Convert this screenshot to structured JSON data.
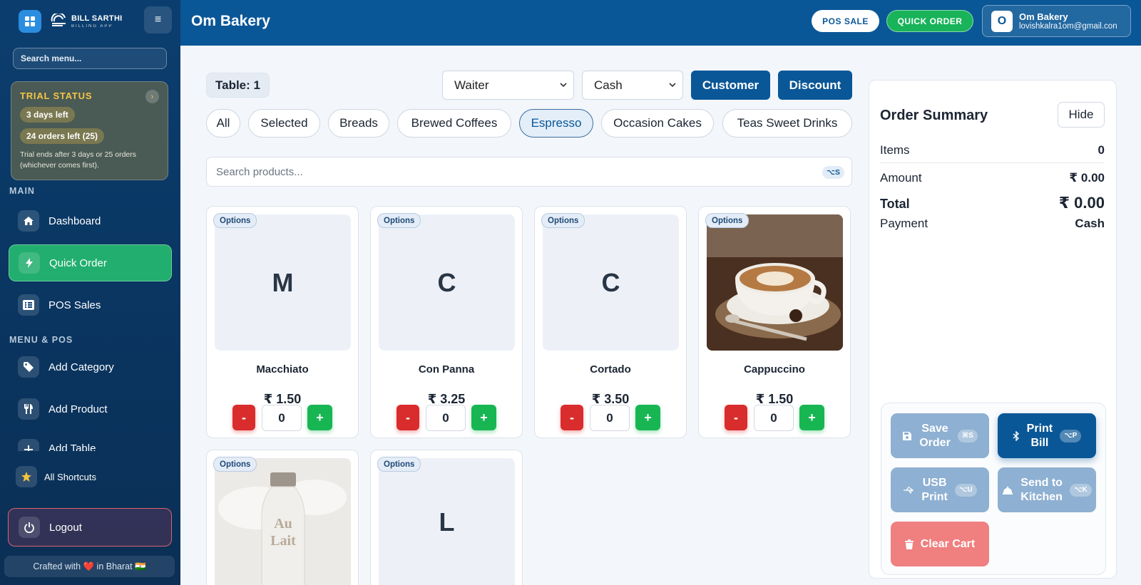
{
  "brand": {
    "name": "BILL SARTHI",
    "tagline": "BILLING APP"
  },
  "sidebar": {
    "search_placeholder": "Search menu...",
    "trial": {
      "title": "TRIAL STATUS",
      "days_left": "3 days left",
      "orders_left": "24 orders left (25)",
      "note": "Trial ends after 3 days or 25 orders (whichever comes first)."
    },
    "section_main": "MAIN",
    "section_menu": "MENU & POS",
    "items": [
      {
        "label": "Dashboard",
        "icon": "home-icon"
      },
      {
        "label": "Quick Order",
        "icon": "bolt-icon",
        "active": true
      },
      {
        "label": "POS Sales",
        "icon": "list-icon"
      },
      {
        "label": "Add Category",
        "icon": "tag-icon"
      },
      {
        "label": "Add Product",
        "icon": "utensils-icon"
      },
      {
        "label": "Add Table",
        "icon": "plus-icon"
      }
    ],
    "shortcuts_label": "All Shortcuts",
    "logout_label": "Logout",
    "crafted": "Crafted with ❤️ in Bharat 🇮🇳"
  },
  "header": {
    "title": "Om Bakery",
    "pos_sale": "POS SALE",
    "quick_order": "QUICK ORDER",
    "account": {
      "initial": "O",
      "name": "Om Bakery",
      "email": "lovishkalra1om@gmail.con"
    }
  },
  "order_bar": {
    "table": "Table: 1",
    "waiter": "Waiter",
    "payment": "Cash",
    "customer_btn": "Customer",
    "discount_btn": "Discount"
  },
  "categories": [
    {
      "label": "All"
    },
    {
      "label": "Selected"
    },
    {
      "label": "Breads"
    },
    {
      "label": "Brewed Coffees"
    },
    {
      "label": "Espresso",
      "active": true
    },
    {
      "label": "Occasion Cakes"
    },
    {
      "label": "Teas Sweet Drinks"
    }
  ],
  "search": {
    "placeholder": "Search products...",
    "shortcut": "⌥S"
  },
  "products": [
    {
      "badge": "Options",
      "letter": "M",
      "name": "Macchiato",
      "price": "₹ 1.50",
      "qty": "0"
    },
    {
      "badge": "Options",
      "letter": "C",
      "name": "Con Panna",
      "price": "₹ 3.25",
      "qty": "0"
    },
    {
      "badge": "Options",
      "letter": "C",
      "name": "Cortado",
      "price": "₹ 3.50",
      "qty": "0"
    },
    {
      "badge": "Options",
      "letter": "",
      "name": "Cappuccino",
      "price": "₹ 1.50",
      "qty": "0",
      "image": "cappuccino-photo"
    },
    {
      "badge": "Options",
      "letter": "",
      "name": "",
      "price": "",
      "qty": "",
      "image": "au-lait-bottle-photo",
      "image_text": "Au Lait"
    },
    {
      "badge": "Options",
      "letter": "L",
      "name": "",
      "price": "",
      "qty": ""
    }
  ],
  "qty_minus": "-",
  "qty_plus": "+",
  "summary": {
    "title": "Order Summary",
    "hide": "Hide",
    "items_label": "Items",
    "items_value": "0",
    "amount_label": "Amount",
    "amount_value": "₹ 0.00",
    "total_label": "Total",
    "total_value": "₹ 0.00",
    "payment_label": "Payment",
    "payment_value": "Cash"
  },
  "actions": {
    "save": {
      "line1": "Save",
      "line2": "Order",
      "key": "⌘S"
    },
    "print": {
      "line1": "Print",
      "line2": "Bill",
      "key": "⌥P"
    },
    "usb": {
      "line1": "USB",
      "line2": "Print",
      "key": "⌥U"
    },
    "kitchen": {
      "line1": "Send to",
      "line2": "Kitchen",
      "key": "⌥K"
    },
    "clear": "Clear Cart"
  },
  "colors": {
    "primary": "#0a5797",
    "accent_green": "#19b35a",
    "danger": "#d92c2c",
    "trial_gold": "#f3c545"
  }
}
